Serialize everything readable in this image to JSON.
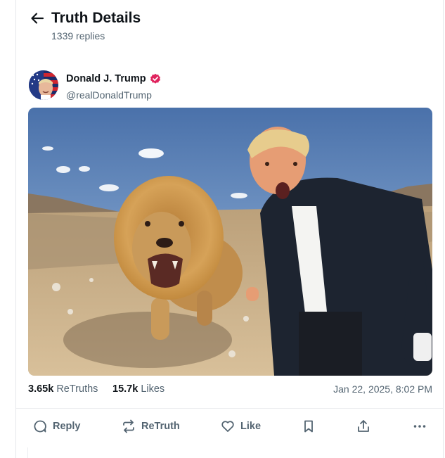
{
  "header": {
    "title": "Truth Details",
    "subtitle": "1339 replies"
  },
  "author": {
    "name": "Donald J. Trump",
    "handle": "@realDonaldTrump",
    "verified": true,
    "verified_color": "#e0245e"
  },
  "media": {
    "type": "photo",
    "sky_color": "#5b82b8",
    "ground_color": "#c8ae88"
  },
  "stats": {
    "retruths_count": "3.65k",
    "retruths_label": "ReTruths",
    "likes_count": "15.7k",
    "likes_label": "Likes",
    "timestamp": "Jan 22, 2025, 8:02 PM"
  },
  "actions": {
    "reply_label": "Reply",
    "retruth_label": "ReTruth",
    "like_label": "Like"
  },
  "icons": [
    "arrow-left-icon",
    "verified-badge-icon",
    "reply-icon",
    "retruth-icon",
    "heart-icon",
    "bookmark-icon",
    "share-icon",
    "more-icon"
  ]
}
